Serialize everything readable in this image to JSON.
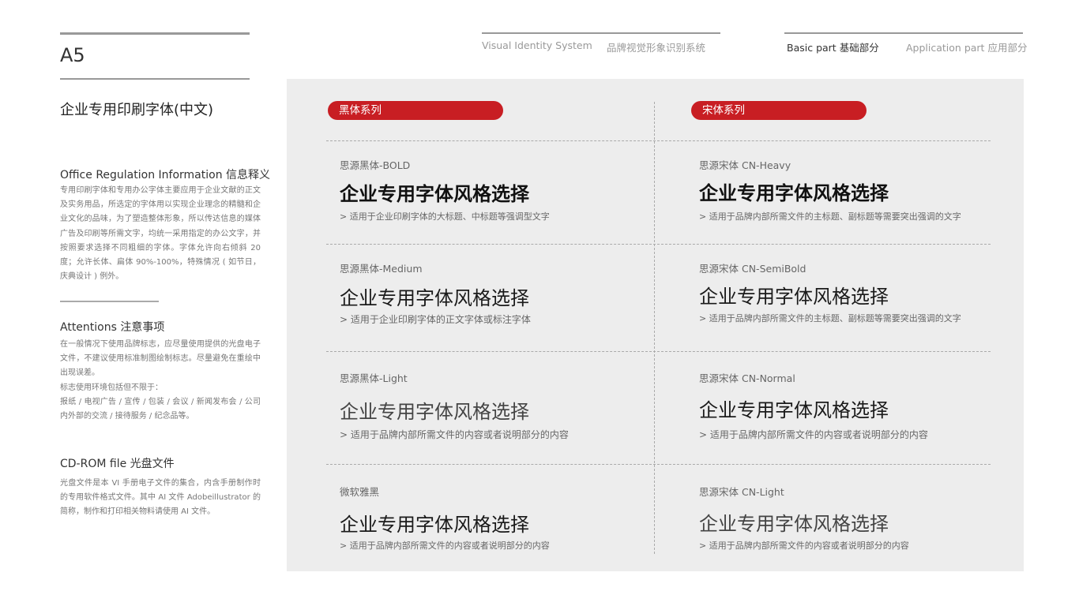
{
  "page": {
    "code": "A5",
    "title": "企业专用印刷字体(中文)"
  },
  "nav": {
    "vis_en": "Visual Identity System",
    "vis_cn": "品牌视觉形象识别系统",
    "basic_en": "Basic part",
    "basic_cn": "基础部分",
    "app_en": "Application part",
    "app_cn": "应用部分"
  },
  "sections": {
    "info": {
      "heading": "Office Regulation Information 信息释义",
      "body": "专用印刷字体和专用办公字体主要应用于企业文献的正文及实务用品，所选定的字体用以实现企业理念的精髓和企业文化的品味，为了塑造整体形象，所以传达信息的媒体广告及印刷等所需文字，均统一采用指定的办公文字，并按照要求选择不同粗细的字体。字体允许向右倾斜 20 度；允许长体、扁体 90%-100%，特殊情况 ( 如节日，庆典设计 ) 例外。"
    },
    "attention": {
      "heading": "Attentions 注意事项",
      "body": "在一般情况下使用品牌标志，应尽量使用提供的光盘电子文件，不建议使用标准制图绘制标志。尽量避免在重绘中出现误差。",
      "body2": "标志使用环境包括但不限于：",
      "body3": "报纸 / 电视广告 / 宣传 / 包装 / 会议 / 新闻发布会 / 公司内外部的交流 / 接待服务 / 纪念品等。"
    },
    "cdrom": {
      "heading": "CD-ROM file 光盘文件",
      "body": "光盘文件是本 VI 手册电子文件的集合，内含手册制作时的专用软件格式文件。其中 AI 文件 Adobeillustrator 的简称，制作和打印相关物料请使用 AI 文件。"
    }
  },
  "fonts": {
    "hei_label": "黑体系列",
    "song_label": "宋体系列",
    "sample": "企业专用字体风格选择",
    "hei": [
      {
        "name": "思源黑体-BOLD",
        "note": "> 适用于企业印刷字体的大标题、中标题等强调型文字"
      },
      {
        "name": "思源黑体-Medium",
        "note": "> 适用于企业印刷字体的正文字体或标注字体"
      },
      {
        "name": "思源黑体-Light",
        "note": "> 适用于品牌内部所需文件的内容或者说明部分的内容"
      },
      {
        "name": "微软雅黑",
        "note": "> 适用于品牌内部所需文件的内容或者说明部分的内容"
      }
    ],
    "song": [
      {
        "name": "思源宋体 CN-Heavy",
        "note": "> 适用于品牌内部所需文件的主标题、副标题等需要突出强调的文字"
      },
      {
        "name": "思源宋体 CN-SemiBold",
        "note": "> 适用于品牌内部所需文件的主标题、副标题等需要突出强调的文字"
      },
      {
        "name": "思源宋体 CN-Normal",
        "note": "> 适用于品牌内部所需文件的内容或者说明部分的内容"
      },
      {
        "name": "思源宋体 CN-Light",
        "note": "> 适用于品牌内部所需文件的内容或者说明部分的内容"
      }
    ]
  },
  "colors": {
    "accent": "#c81e23",
    "panel": "#ededed"
  }
}
